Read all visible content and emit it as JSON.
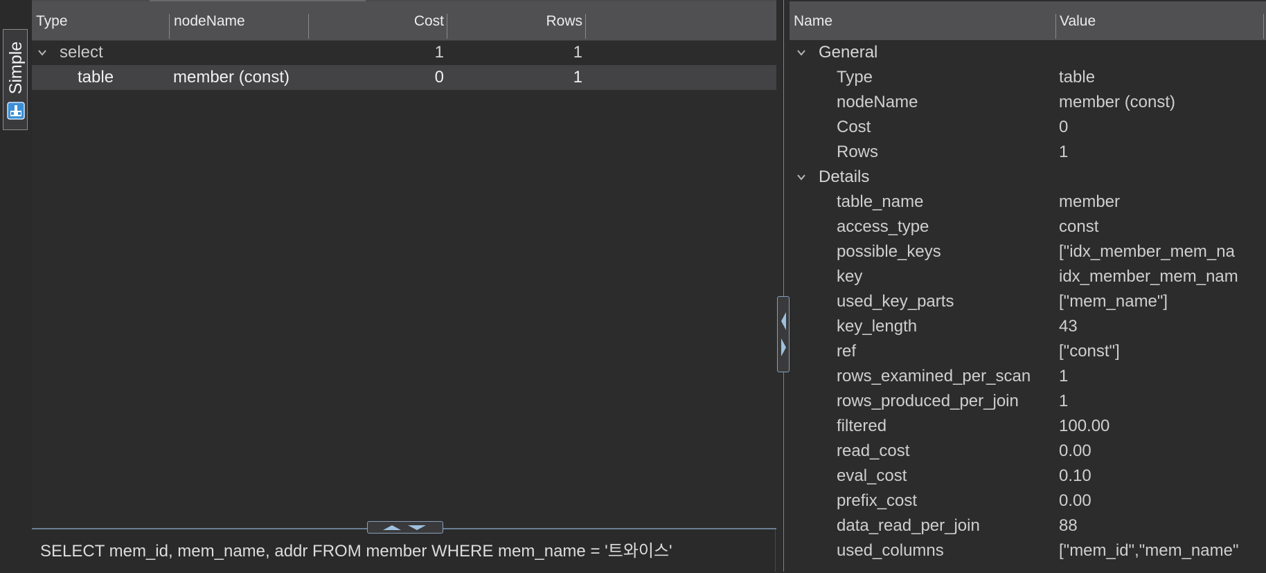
{
  "side_tab": {
    "label": "Simple",
    "icon": "plan-view-icon"
  },
  "plan_table": {
    "columns": [
      "Type",
      "nodeName",
      "Cost",
      "Rows"
    ],
    "rows": [
      {
        "type": "select",
        "node_name": "",
        "cost": "1",
        "rows": "1",
        "expanded": true
      },
      {
        "type": "table",
        "node_name": "member (const)",
        "cost": "0",
        "rows": "1",
        "selected": true
      }
    ]
  },
  "sql": {
    "text": "SELECT mem_id, mem_name, addr FROM member WHERE mem_name = '트와이스'"
  },
  "properties": {
    "columns": [
      "Name",
      "Value"
    ],
    "groups": [
      {
        "name": "General",
        "items": [
          {
            "name": "Type",
            "value": "table"
          },
          {
            "name": "nodeName",
            "value": "member (const)"
          },
          {
            "name": "Cost",
            "value": "0"
          },
          {
            "name": "Rows",
            "value": "1"
          }
        ]
      },
      {
        "name": "Details",
        "items": [
          {
            "name": "table_name",
            "value": "member"
          },
          {
            "name": "access_type",
            "value": "const"
          },
          {
            "name": "possible_keys",
            "value": "[\"idx_member_mem_na"
          },
          {
            "name": "key",
            "value": "idx_member_mem_nam"
          },
          {
            "name": "used_key_parts",
            "value": "[\"mem_name\"]"
          },
          {
            "name": "key_length",
            "value": "43"
          },
          {
            "name": "ref",
            "value": "[\"const\"]"
          },
          {
            "name": "rows_examined_per_scan",
            "value": "1"
          },
          {
            "name": "rows_produced_per_join",
            "value": "1"
          },
          {
            "name": "filtered",
            "value": "100.00"
          },
          {
            "name": "read_cost",
            "value": "0.00"
          },
          {
            "name": "eval_cost",
            "value": "0.10"
          },
          {
            "name": "prefix_cost",
            "value": "0.00"
          },
          {
            "name": "data_read_per_join",
            "value": "88"
          },
          {
            "name": "used_columns",
            "value": "[\"mem_id\",\"mem_name\""
          }
        ]
      }
    ]
  },
  "colors": {
    "header_bg": "#505052",
    "selected_row": "#434345",
    "panel_bg": "#2c2c2d",
    "accent": "#8aa0b8"
  }
}
